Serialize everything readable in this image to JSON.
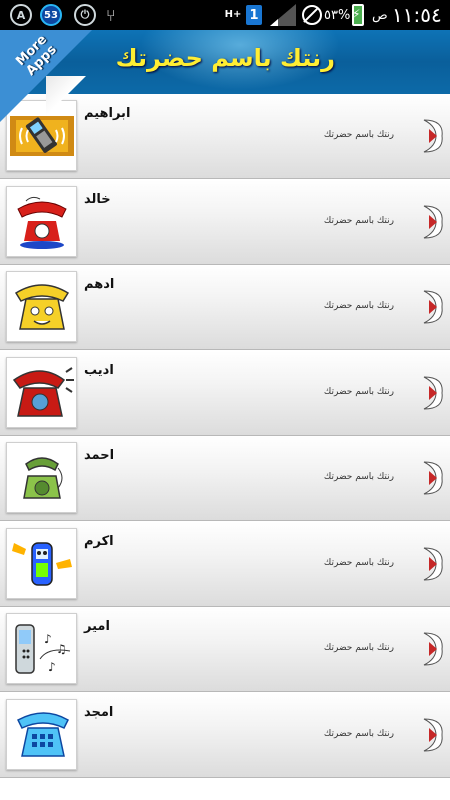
{
  "status_bar": {
    "notification_badge": "53",
    "network_type": "H+",
    "sim_slot": "1",
    "battery_percent": "٥٣%",
    "time_suffix": "ص",
    "time": "١١:٥٤"
  },
  "header": {
    "title": "رنتك باسم حضرتك",
    "more_apps_label": "More Apps"
  },
  "list": {
    "items": [
      {
        "name": "ابراهيم",
        "subtitle": "رنتك باسم حضرتك",
        "icon": "vibrating-phone-icon"
      },
      {
        "name": "خالد",
        "subtitle": "رنتك باسم حضرتك",
        "icon": "red-phone-icon"
      },
      {
        "name": "ادهم",
        "subtitle": "رنتك باسم حضرتك",
        "icon": "cartoon-phone-icon"
      },
      {
        "name": "اديب",
        "subtitle": "رنتك باسم حضرتك",
        "icon": "ringing-red-phone-icon"
      },
      {
        "name": "احمد",
        "subtitle": "رنتك باسم حضرتك",
        "icon": "green-phone-icon"
      },
      {
        "name": "اكرم",
        "subtitle": "رنتك باسم حضرتك",
        "icon": "mobile-character-icon"
      },
      {
        "name": "امير",
        "subtitle": "رنتك باسم حضرتك",
        "icon": "mobile-music-icon"
      },
      {
        "name": "امجد",
        "subtitle": "رنتك باسم حضرتك",
        "icon": "blue-phone-icon"
      }
    ]
  },
  "colors": {
    "header_bg": "#0a5f9b",
    "title_color": "#ffee33",
    "play_accent": "#c62828"
  }
}
